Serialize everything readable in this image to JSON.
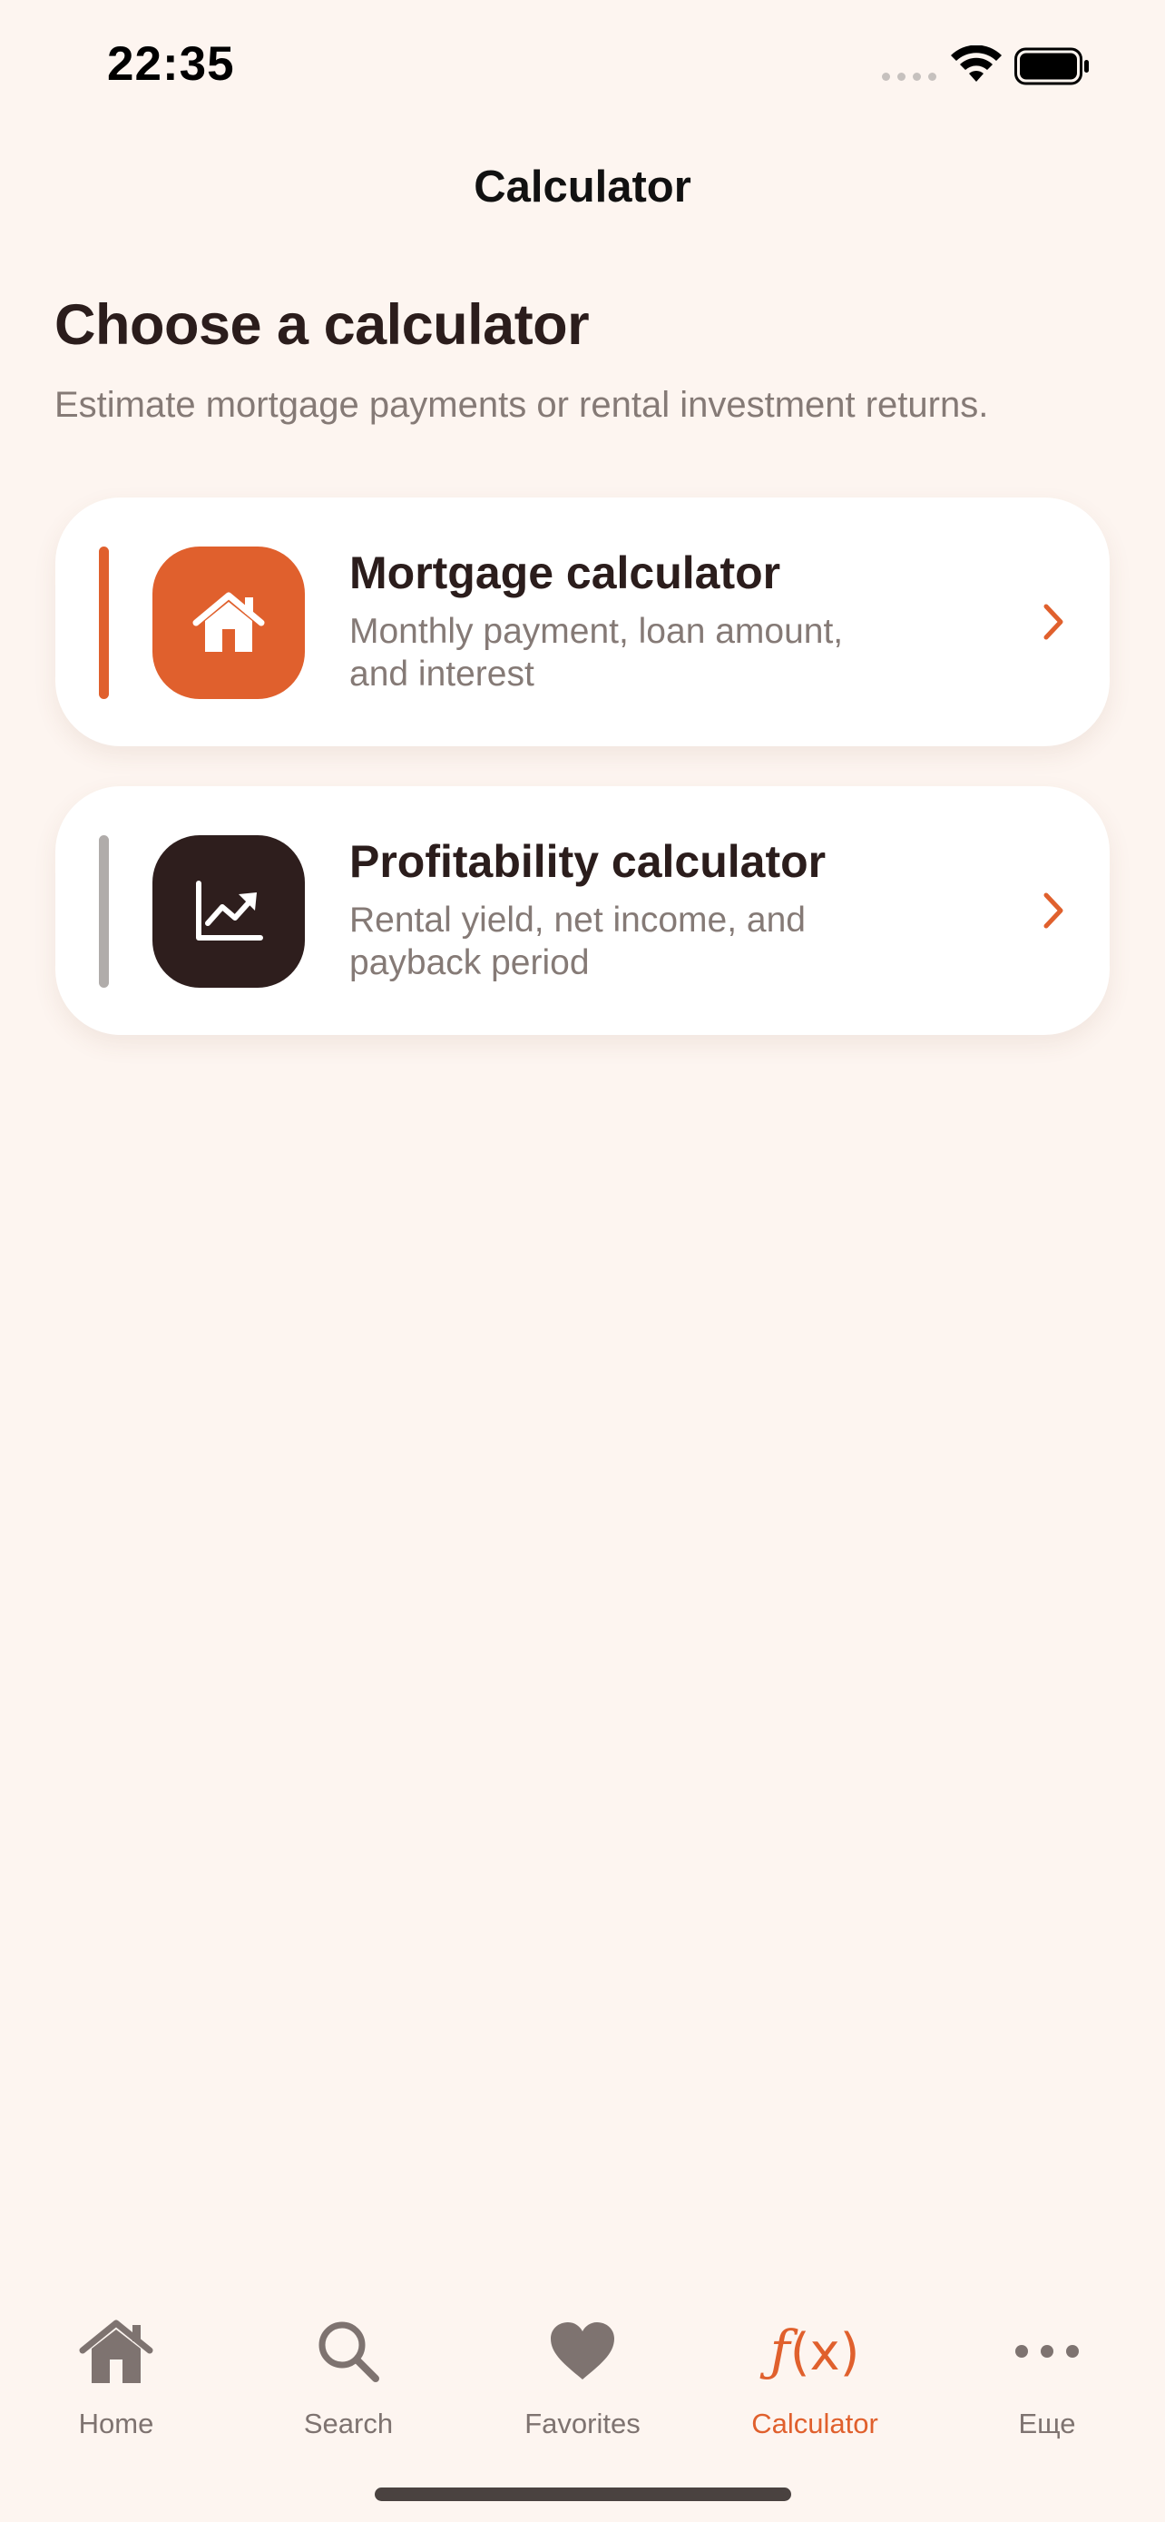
{
  "status_bar": {
    "time": "22:35"
  },
  "nav": {
    "title": "Calculator"
  },
  "header": {
    "title": "Choose a calculator",
    "subtitle": "Estimate mortgage payments or rental investment returns."
  },
  "cards": [
    {
      "title": "Mortgage calculator",
      "description": "Monthly payment, loan amount, and interest",
      "icon": "house-icon",
      "accent_color": "#E0602D",
      "tile_color": "#E0602D"
    },
    {
      "title": "Profitability calculator",
      "description": "Rental yield, net income, and payback period",
      "icon": "chart-trending-up-icon",
      "accent_color": "#B0ACAA",
      "tile_color": "#2E1E1D"
    }
  ],
  "tab_bar": {
    "tabs": [
      {
        "label": "Home",
        "icon": "house-icon"
      },
      {
        "label": "Search",
        "icon": "magnifier-icon"
      },
      {
        "label": "Favorites",
        "icon": "heart-icon"
      },
      {
        "label": "Calculator",
        "icon": "function-fx-icon",
        "active": true
      },
      {
        "label": "Еще",
        "icon": "ellipsis-icon"
      }
    ],
    "active_color": "#E0602D",
    "inactive_color": "#7E7370"
  }
}
